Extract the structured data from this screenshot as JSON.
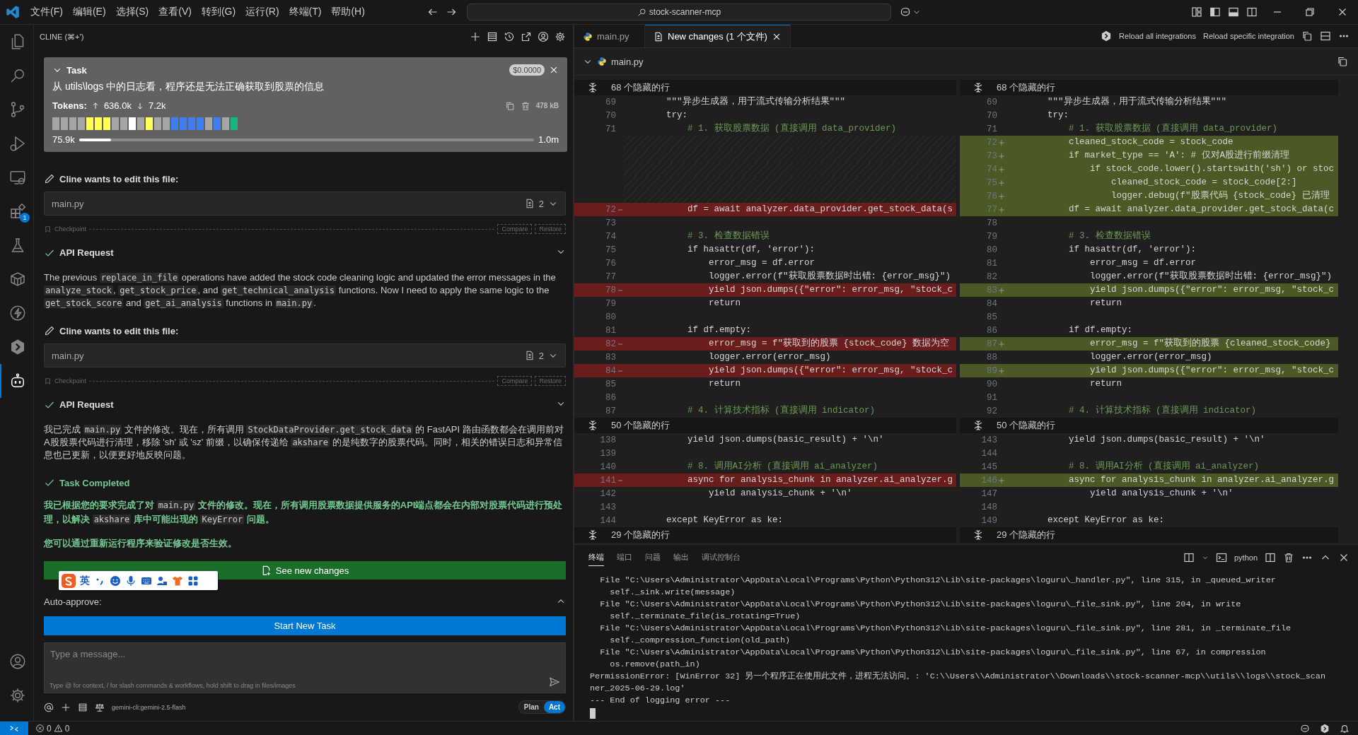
{
  "title_bar": {
    "menus": [
      "文件(F)",
      "编辑(E)",
      "选择(S)",
      "查看(V)",
      "转到(G)",
      "运行(R)",
      "终端(T)",
      "帮助(H)"
    ],
    "search": "stock-scanner-mcp"
  },
  "activity_bar": {
    "items": [
      {
        "kind": "files",
        "selected": false
      },
      {
        "kind": "search",
        "selected": false
      },
      {
        "kind": "branch",
        "selected": false
      },
      {
        "kind": "debug",
        "selected": false
      },
      {
        "kind": "remote",
        "selected": false
      },
      {
        "kind": "extensions",
        "selected": false,
        "badge": "1"
      },
      {
        "kind": "flask",
        "selected": false
      },
      {
        "kind": "cube",
        "selected": false
      },
      {
        "kind": "bolt",
        "selected": false
      },
      {
        "kind": "hexagon",
        "selected": false
      },
      {
        "kind": "robot",
        "selected": true
      }
    ],
    "bottom": [
      {
        "kind": "account"
      },
      {
        "kind": "gear"
      }
    ]
  },
  "cline": {
    "header": "CLINE (⌘+')",
    "task": {
      "title": "Task",
      "cost": "$0.0000",
      "text": "从 utils\\logs 中的日志看，程序还是无法正确获取到股票的信息",
      "tokens_label": "Tokens:",
      "tokens_in": "636.0k",
      "tokens_out": "7.2k",
      "size": "478 kB",
      "context_blocks": [
        {
          "color": "#a6a6a6"
        },
        {
          "color": "#a6a6a6"
        },
        {
          "color": "#a6a6a6"
        },
        {
          "color": "#a6a6a6"
        },
        {
          "color": "#ffff55"
        },
        {
          "color": "#ffff55"
        },
        {
          "color": "#ffff55"
        },
        {
          "color": "#a6a6a6"
        },
        {
          "color": "#a6a6a6"
        },
        {
          "color": "#ffffff"
        },
        {
          "color": "#a6a6a6"
        },
        {
          "color": "#ffff55"
        },
        {
          "color": "#a6a6a6"
        },
        {
          "color": "#a6a6a6"
        },
        {
          "color": "#3d7ef0"
        },
        {
          "color": "#3d7ef0"
        },
        {
          "color": "#3d7ef0"
        },
        {
          "color": "#3d7ef0"
        },
        {
          "color": "#a6a6a6"
        },
        {
          "color": "#3d7ef0"
        },
        {
          "color": "#a6a6a6"
        },
        {
          "color": "#17b877"
        }
      ],
      "context_used": "75.9k",
      "context_max": "1.0m",
      "level": 0.07
    },
    "messages": [
      {
        "kind": "edit",
        "title": "Cline wants to edit this file:",
        "file": "main.py",
        "count": "2"
      },
      {
        "kind": "checkpoint",
        "label": "Checkpoint",
        "compare": "Compare",
        "restore": "Restore"
      },
      {
        "kind": "api",
        "title": "API Request"
      },
      {
        "kind": "paragraph",
        "segments": [
          {
            "kind": "text",
            "text": "The previous "
          },
          {
            "kind": "code",
            "text": "replace_in_file"
          },
          {
            "kind": "text",
            "text": " operations have added the stock code cleaning logic and updated the error messages in the "
          },
          {
            "kind": "code",
            "text": "analyze_stock"
          },
          {
            "kind": "text",
            "text": ", "
          },
          {
            "kind": "code",
            "text": "get_stock_price"
          },
          {
            "kind": "text",
            "text": ", and "
          },
          {
            "kind": "code",
            "text": "get_technical_analysis"
          },
          {
            "kind": "text",
            "text": " functions. Now I need to apply the same logic to the "
          },
          {
            "kind": "code",
            "text": "get_stock_score"
          },
          {
            "kind": "text",
            "text": " and "
          },
          {
            "kind": "code",
            "text": "get_ai_analysis"
          },
          {
            "kind": "text",
            "text": " functions in "
          },
          {
            "kind": "code",
            "text": "main.py"
          },
          {
            "kind": "text",
            "text": "."
          }
        ]
      },
      {
        "kind": "edit",
        "title": "Cline wants to edit this file:",
        "file": "main.py",
        "count": "2"
      },
      {
        "kind": "checkpoint",
        "label": "Checkpoint",
        "compare": "Compare",
        "restore": "Restore"
      },
      {
        "kind": "api",
        "title": "API Request"
      },
      {
        "kind": "paragraph",
        "segments": [
          {
            "kind": "text",
            "text": "我已完成 "
          },
          {
            "kind": "code",
            "text": "main.py"
          },
          {
            "kind": "text",
            "text": " 文件的修改。现在，所有调用 "
          },
          {
            "kind": "code",
            "text": "StockDataProvider.get_stock_data"
          },
          {
            "kind": "text",
            "text": " 的 FastAPI 路由函数都会在调用前对A股股票代码进行清理，移除 'sh' 或 'sz' 前缀，以确保传递给 "
          },
          {
            "kind": "code",
            "text": "akshare"
          },
          {
            "kind": "text",
            "text": " 的是纯数字的股票代码。同时，相关的错误日志和异常信息也已更新，以便更好地反映问题。"
          }
        ]
      },
      {
        "kind": "completed",
        "title": "Task Completed"
      },
      {
        "kind": "result",
        "segments": [
          {
            "kind": "text",
            "text": "我已根据您的要求完成了对 "
          },
          {
            "kind": "code",
            "text": "main.py"
          },
          {
            "kind": "text",
            "text": " 文件的修改。现在，所有调用股票数据提供服务的API端点都会在内部对股票代码进行预处理，以解决 "
          },
          {
            "kind": "code",
            "text": "akshare"
          },
          {
            "kind": "text",
            "text": " 库中可能出现的 "
          },
          {
            "kind": "code",
            "text": "KeyError"
          },
          {
            "kind": "text",
            "text": " 问题。"
          }
        ]
      },
      {
        "kind": "result",
        "segments": [
          {
            "kind": "text",
            "text": "您可以通过重新运行程序来验证修改是否生效。"
          }
        ]
      }
    ],
    "see_changes": "See new changes",
    "ime": {
      "label": "英"
    },
    "auto_approve": "Auto-approve:",
    "start_task": "Start New Task",
    "input": {
      "placeholder": "Type a message...",
      "hint": "Type @ for context, / for slash commands & workflows, hold shift to drag in files/images"
    },
    "model": "gemini-cli:gemini-2.5-flash",
    "modes": [
      {
        "label": "Plan",
        "selected": false
      },
      {
        "label": "Act",
        "selected": true
      }
    ]
  },
  "editor": {
    "tabs": [
      {
        "label": "main.py",
        "kind": "python",
        "selected": false
      },
      {
        "label": "New changes (1 个文件)",
        "kind": "diff",
        "selected": true
      }
    ],
    "actions": [
      "Reload all integrations",
      "Reload specific integration"
    ],
    "diff": {
      "file": "main.py",
      "hunks": [
        {
          "hidden_left": "68 个隐藏的行",
          "hidden_right": "68 个隐藏的行",
          "left": [
            {
              "num": "69",
              "code": "        \"\"\"异步生成器，用于流式传输分析结果\"\"\"",
              "kind": "context",
              "comment": false
            },
            {
              "num": "70",
              "code": "        try:",
              "kind": "context",
              "comment": false
            },
            {
              "num": "71",
              "code": "            # 1. 获取股票数据 (直接调用 data_provider)",
              "kind": "context",
              "comment": true
            },
            {
              "kind": "filler"
            },
            {
              "kind": "filler"
            },
            {
              "kind": "filler"
            },
            {
              "kind": "filler"
            },
            {
              "kind": "filler"
            },
            {
              "num": "72",
              "code": "            df = await analyzer.data_provider.get_stock_data(s",
              "kind": "removed",
              "comment": false
            },
            {
              "num": "73",
              "kind": "context"
            },
            {
              "num": "74",
              "code": "            # 3. 检查数据错误",
              "kind": "context",
              "comment": true
            },
            {
              "num": "75",
              "code": "            if hasattr(df, 'error'):",
              "kind": "context",
              "comment": false
            },
            {
              "num": "76",
              "code": "                error_msg = df.error",
              "kind": "context",
              "comment": false
            },
            {
              "num": "77",
              "code": "                logger.error(f\"获取股票数据时出错: {error_msg}\")",
              "kind": "context",
              "comment": false
            },
            {
              "num": "78",
              "code": "                yield json.dumps({\"error\": error_msg, \"stock_c",
              "kind": "removed",
              "comment": false
            },
            {
              "num": "79",
              "code": "                return",
              "kind": "context",
              "comment": false
            },
            {
              "num": "80",
              "kind": "context"
            },
            {
              "num": "81",
              "code": "            if df.empty:",
              "kind": "context",
              "comment": false
            },
            {
              "num": "82",
              "code": "                error_msg = f\"获取到的股票 {stock_code} 数据为空",
              "kind": "removed",
              "comment": false
            },
            {
              "num": "83",
              "code": "                logger.error(error_msg)",
              "kind": "context",
              "comment": false
            },
            {
              "num": "84",
              "code": "                yield json.dumps({\"error\": error_msg, \"stock_c",
              "kind": "removed",
              "comment": false
            },
            {
              "num": "85",
              "code": "                return",
              "kind": "context",
              "comment": false
            },
            {
              "num": "86",
              "kind": "context"
            },
            {
              "num": "87",
              "code": "            # 4. 计算技术指标 (直接调用 indicator)",
              "kind": "context",
              "comment": true
            }
          ],
          "right": [
            {
              "num": "69",
              "code": "        \"\"\"异步生成器，用于流式传输分析结果\"\"\"",
              "kind": "context",
              "comment": false
            },
            {
              "num": "70",
              "code": "        try:",
              "kind": "context",
              "comment": false
            },
            {
              "num": "71",
              "code": "            # 1. 获取股票数据 (直接调用 data_provider)",
              "kind": "context",
              "comment": true
            },
            {
              "num": "72",
              "code": "            cleaned_stock_code = stock_code",
              "kind": "added",
              "comment": false
            },
            {
              "num": "73",
              "code": "            if market_type == 'A': # 仅对A股进行前缀清理",
              "kind": "added",
              "comment": false
            },
            {
              "num": "74",
              "code": "                if stock_code.lower().startswith('sh') or stoc",
              "kind": "added",
              "comment": false
            },
            {
              "num": "75",
              "code": "                    cleaned_stock_code = stock_code[2:]",
              "kind": "added",
              "comment": false
            },
            {
              "num": "76",
              "code": "                    logger.debug(f\"股票代码 {stock_code} 已清理",
              "kind": "added",
              "comment": false
            },
            {
              "num": "77",
              "code": "            df = await analyzer.data_provider.get_stock_data(c",
              "kind": "added",
              "comment": false
            },
            {
              "num": "78",
              "kind": "context"
            },
            {
              "num": "79",
              "code": "            # 3. 检查数据错误",
              "kind": "context",
              "comment": true
            },
            {
              "num": "80",
              "code": "            if hasattr(df, 'error'):",
              "kind": "context",
              "comment": false
            },
            {
              "num": "81",
              "code": "                error_msg = df.error",
              "kind": "context",
              "comment": false
            },
            {
              "num": "82",
              "code": "                logger.error(f\"获取股票数据时出错: {error_msg}\")",
              "kind": "context",
              "comment": false
            },
            {
              "num": "83",
              "code": "                yield json.dumps({\"error\": error_msg, \"stock_c",
              "kind": "added",
              "comment": false
            },
            {
              "num": "84",
              "code": "                return",
              "kind": "context",
              "comment": false
            },
            {
              "num": "85",
              "kind": "context"
            },
            {
              "num": "86",
              "code": "            if df.empty:",
              "kind": "context",
              "comment": false
            },
            {
              "num": "87",
              "code": "                error_msg = f\"获取到的股票 {cleaned_stock_code}",
              "kind": "added",
              "comment": false
            },
            {
              "num": "88",
              "code": "                logger.error(error_msg)",
              "kind": "context",
              "comment": false
            },
            {
              "num": "89",
              "code": "                yield json.dumps({\"error\": error_msg, \"stock_c",
              "kind": "added",
              "comment": false
            },
            {
              "num": "90",
              "code": "                return",
              "kind": "context",
              "comment": false
            },
            {
              "num": "91",
              "kind": "context"
            },
            {
              "num": "92",
              "code": "            # 4. 计算技术指标 (直接调用 indicator)",
              "kind": "context",
              "comment": true
            }
          ]
        },
        {
          "hidden_left": "50 个隐藏的行",
          "hidden_right": "50 个隐藏的行",
          "left": [
            {
              "num": "138",
              "code": "            yield json.dumps(basic_result) + '\\n'",
              "kind": "context",
              "comment": false
            },
            {
              "num": "139",
              "kind": "context"
            },
            {
              "num": "140",
              "code": "            # 8. 调用AI分析 (直接调用 ai_analyzer)",
              "kind": "context",
              "comment": true
            },
            {
              "num": "141",
              "code": "            async for analysis_chunk in analyzer.ai_analyzer.g",
              "kind": "removed",
              "comment": false
            },
            {
              "num": "142",
              "code": "                yield analysis_chunk + '\\n'",
              "kind": "context",
              "comment": false
            },
            {
              "num": "143",
              "kind": "context"
            },
            {
              "num": "144",
              "code": "        except KeyError as ke:",
              "kind": "context",
              "comment": false
            }
          ],
          "right": [
            {
              "num": "143",
              "code": "            yield json.dumps(basic_result) + '\\n'",
              "kind": "context",
              "comment": false
            },
            {
              "num": "144",
              "kind": "context"
            },
            {
              "num": "145",
              "code": "            # 8. 调用AI分析 (直接调用 ai_analyzer)",
              "kind": "context",
              "comment": true
            },
            {
              "num": "146",
              "code": "            async for analysis_chunk in analyzer.ai_analyzer.g",
              "kind": "added",
              "comment": false
            },
            {
              "num": "147",
              "code": "                yield analysis_chunk + '\\n'",
              "kind": "context",
              "comment": false
            },
            {
              "num": "148",
              "kind": "context"
            },
            {
              "num": "149",
              "code": "        except KeyError as ke:",
              "kind": "context",
              "comment": false
            }
          ]
        },
        {
          "hidden_left": "29 个隐藏的行",
          "hidden_right": "29 个隐藏的行"
        }
      ]
    }
  },
  "terminal": {
    "tabs": [
      {
        "label": "终端",
        "selected": true
      },
      {
        "label": "端口",
        "selected": false
      },
      {
        "label": "问题",
        "selected": false
      },
      {
        "label": "输出",
        "selected": false
      },
      {
        "label": "调试控制台",
        "selected": false
      }
    ],
    "shell": "python",
    "lines": [
      "  File \"C:\\Users\\Administrator\\AppData\\Local\\Programs\\Python\\Python312\\Lib\\site-packages\\loguru\\_handler.py\", line 315, in _queued_writer",
      "    self._sink.write(message)",
      "  File \"C:\\Users\\Administrator\\AppData\\Local\\Programs\\Python\\Python312\\Lib\\site-packages\\loguru\\_file_sink.py\", line 204, in write",
      "    self._terminate_file(is_rotating=True)",
      "  File \"C:\\Users\\Administrator\\AppData\\Local\\Programs\\Python\\Python312\\Lib\\site-packages\\loguru\\_file_sink.py\", line 281, in _terminate_file",
      "    self._compression_function(old_path)",
      "  File \"C:\\Users\\Administrator\\AppData\\Local\\Programs\\Python\\Python312\\Lib\\site-packages\\loguru\\_file_sink.py\", line 67, in compression",
      "    os.remove(path_in)",
      "PermissionError: [WinError 32] 另一个程序正在使用此文件，进程无法访问。: 'C:\\\\Users\\\\Administrator\\\\Downloads\\\\stock-scanner-mcp\\\\utils\\\\logs\\\\stock_scan",
      "ner_2025-06-29.log'",
      "--- End of logging error ---"
    ]
  },
  "status_bar": {
    "errors": "0",
    "warnings": "0"
  }
}
